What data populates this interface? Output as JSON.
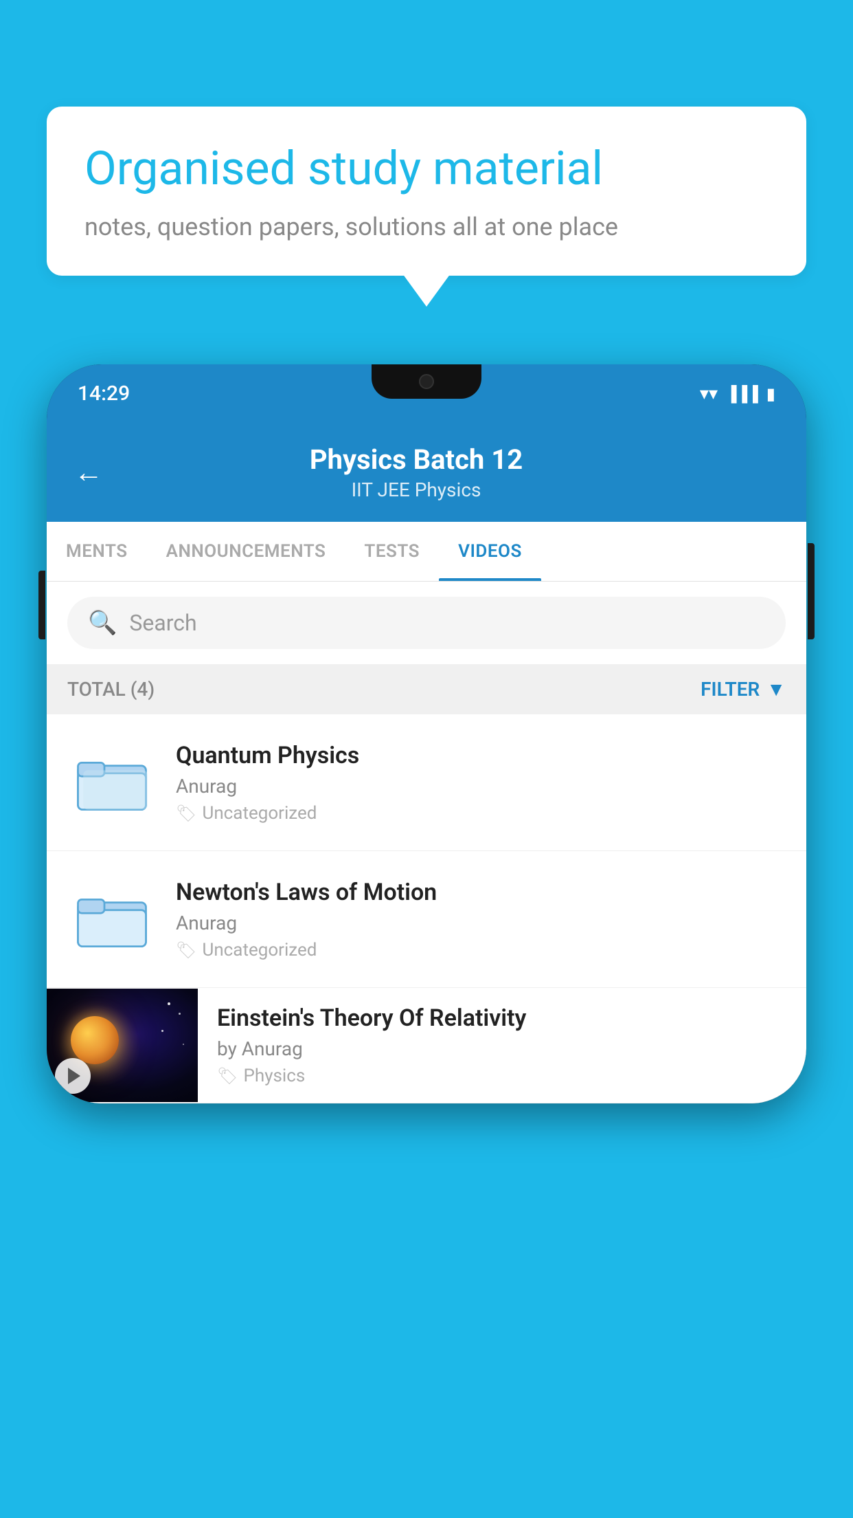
{
  "background_color": "#1db8e8",
  "bubble": {
    "title": "Organised study material",
    "subtitle": "notes, question papers, solutions all at one place"
  },
  "phone": {
    "status_bar": {
      "time": "14:29"
    },
    "header": {
      "title": "Physics Batch 12",
      "subtitle": "IIT JEE   Physics",
      "back_label": "←"
    },
    "tabs": [
      {
        "label": "MENTS",
        "active": false
      },
      {
        "label": "ANNOUNCEMENTS",
        "active": false
      },
      {
        "label": "TESTS",
        "active": false
      },
      {
        "label": "VIDEOS",
        "active": true
      }
    ],
    "search": {
      "placeholder": "Search"
    },
    "filter": {
      "total_label": "TOTAL (4)",
      "filter_label": "FILTER"
    },
    "videos": [
      {
        "id": "quantum",
        "title": "Quantum Physics",
        "author": "Anurag",
        "tag": "Uncategorized",
        "has_thumbnail": false
      },
      {
        "id": "newton",
        "title": "Newton's Laws of Motion",
        "author": "Anurag",
        "tag": "Uncategorized",
        "has_thumbnail": false
      },
      {
        "id": "einstein",
        "title": "Einstein's Theory Of Relativity",
        "author": "by Anurag",
        "tag": "Physics",
        "has_thumbnail": true
      }
    ]
  }
}
